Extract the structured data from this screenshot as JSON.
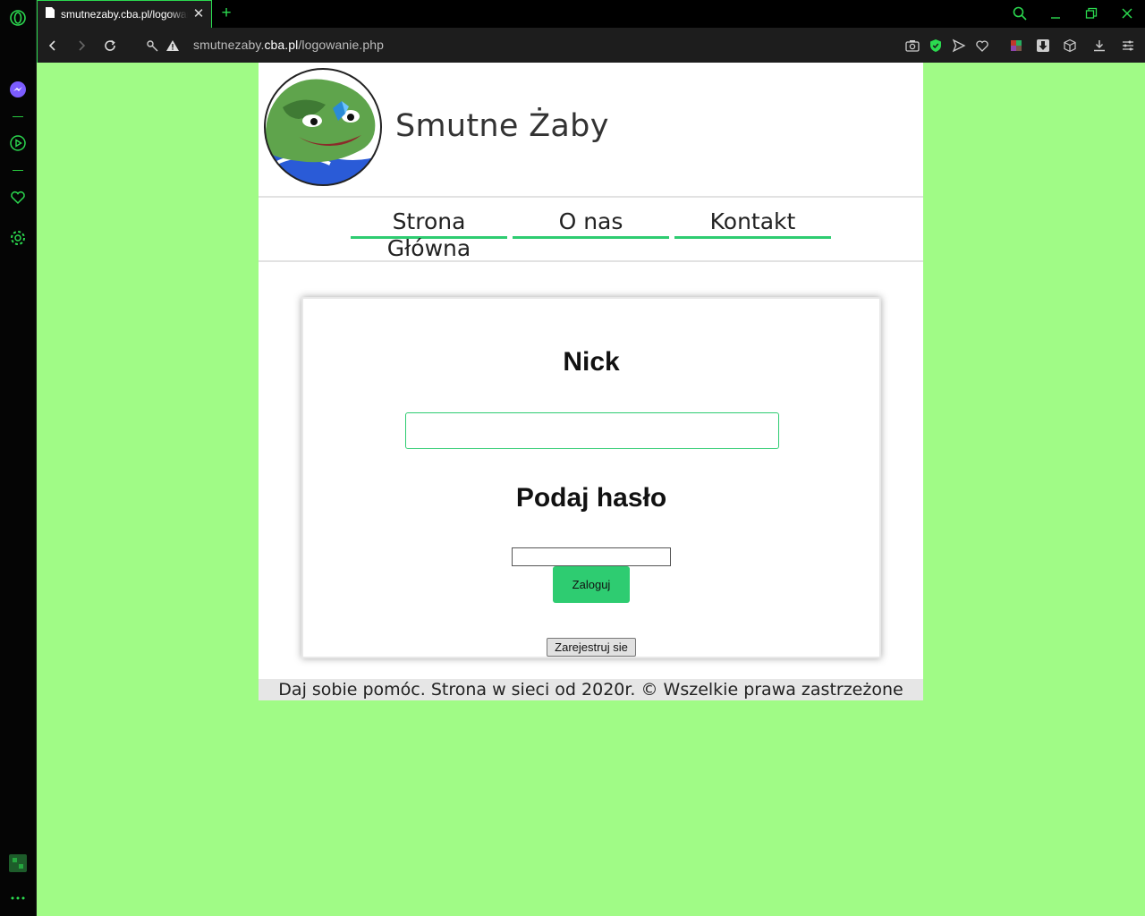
{
  "browser": {
    "tab": {
      "title": "smutnezaby.cba.pl/logowanie.php"
    },
    "url": {
      "prefix": "smutnezaby.",
      "domain": "cba.pl",
      "path": "/logowanie.php"
    },
    "accent_color": "#2bd94f"
  },
  "site": {
    "title": "Smutne Żaby",
    "background_color": "#a0fb86",
    "nav": [
      {
        "label": "Strona Główna"
      },
      {
        "label": "O nas"
      },
      {
        "label": "Kontakt"
      }
    ],
    "form": {
      "nick_label": "Nick",
      "nick_value": "",
      "password_label": "Podaj hasło",
      "password_value": "",
      "login_button": "Zaloguj",
      "register_button": "Zarejestruj sie",
      "button_color": "#2ecc71"
    },
    "footer": "Daj sobie pomóc. Strona w sieci od 2020r. © Wszelkie prawa zastrzeżone"
  },
  "icons": {
    "sidebar": [
      "opera-logo-icon",
      "messenger-icon",
      "player-icon",
      "heart-icon",
      "settings-icon",
      "workspace-icon",
      "more-icon"
    ],
    "toolbar": [
      "back-icon",
      "forward-icon",
      "reload-icon",
      "key-icon",
      "warning-icon",
      "camera-icon",
      "shield-icon",
      "send-icon",
      "heart-icon",
      "extension-icon",
      "download-arrow-icon",
      "cube-icon",
      "download-icon",
      "menu-icon"
    ],
    "window": [
      "search-icon",
      "minimize-icon",
      "restore-icon",
      "close-icon"
    ]
  }
}
